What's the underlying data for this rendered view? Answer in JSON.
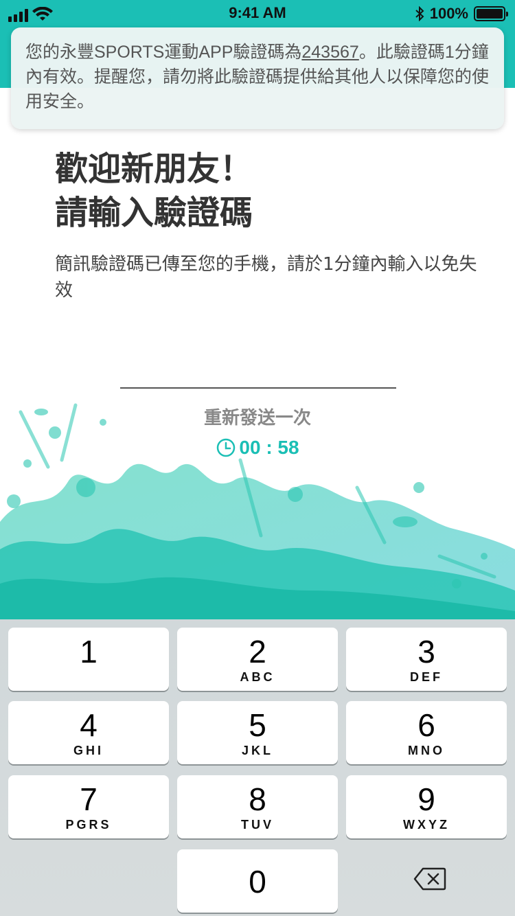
{
  "status_bar": {
    "time": "9:41 AM",
    "battery": "100%"
  },
  "notification": {
    "text_before": "您的永豐SPORTS運動APP驗證碼為",
    "code": "243567",
    "text_after": "。此驗證碼1分鐘內有效。提醒您，請勿將此驗證碼提供給其他人以保障您的使用安全。"
  },
  "hero": {
    "title_line1": "歡迎新朋友！",
    "title_line2": "請輸入驗證碼",
    "subtitle": "簡訊驗證碼已傳至您的手機，請於1分鐘內輸入以免失效"
  },
  "verification": {
    "resend_label": "重新發送一次",
    "countdown": "00 : 58"
  },
  "colors": {
    "accent": "#1bbfb5",
    "keypad_bg": "#d3d9db"
  },
  "keypad": {
    "keys": [
      {
        "num": "1",
        "letters": ""
      },
      {
        "num": "2",
        "letters": "ABC"
      },
      {
        "num": "3",
        "letters": "DEF"
      },
      {
        "num": "4",
        "letters": "GHI"
      },
      {
        "num": "5",
        "letters": "JKL"
      },
      {
        "num": "6",
        "letters": "MNO"
      },
      {
        "num": "7",
        "letters": "PGRS"
      },
      {
        "num": "8",
        "letters": "TUV"
      },
      {
        "num": "9",
        "letters": "WXYZ"
      },
      {
        "num": "0",
        "letters": ""
      }
    ],
    "delete_icon": "delete-backspace-icon"
  }
}
